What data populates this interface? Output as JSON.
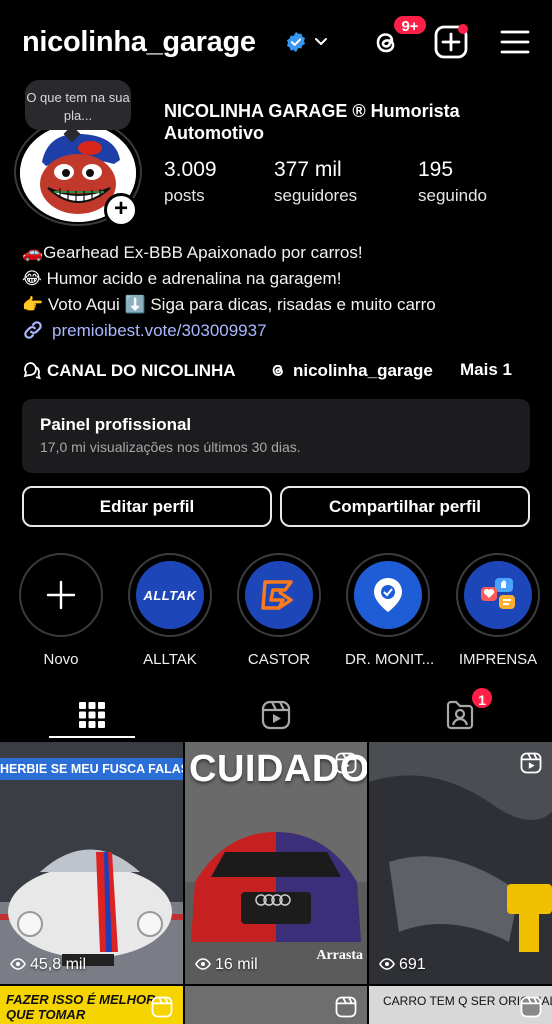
{
  "header": {
    "username": "nicolinha_garage",
    "notification_count": "9+",
    "icons": [
      "verified-badge-icon",
      "chevron-down-icon",
      "threads-icon",
      "add-post-icon",
      "hamburger-menu-icon"
    ]
  },
  "profile": {
    "note_bubble": "O que tem na sua pla...",
    "full_name": "NICOLINHA GARAGE ®  Humorista Automotivo",
    "stats": [
      {
        "value": "3.009",
        "label": "posts"
      },
      {
        "value": "377 mil",
        "label": "seguidores"
      },
      {
        "value": "195",
        "label": "seguindo"
      }
    ],
    "bio": [
      "🚗Gearhead Ex-BBB Apaixonado por carros!",
      "😂 Humor acido e adrenalina na garagem!",
      "👉 Voto Aqui ⬇️ Siga para dicas, risadas e muito carro"
    ],
    "link": "premioibest.vote/303009937",
    "chips": {
      "channel": "CANAL DO NICOLINHA",
      "threads": "nicolinha_garage",
      "more": "Mais 1"
    }
  },
  "pro_panel": {
    "title": "Painel profissional",
    "subtitle": "17,0 mi visualizações nos últimos 30 dias."
  },
  "buttons": {
    "edit": "Editar perfil",
    "share": "Compartilhar perfil"
  },
  "highlights": [
    {
      "label": "Novo"
    },
    {
      "label": "ALLTAK",
      "logo_text": "ALLTAK"
    },
    {
      "label": "CASTOR"
    },
    {
      "label": "DR. MONIT..."
    },
    {
      "label": "IMPRENSA"
    }
  ],
  "tabs": {
    "tagged_badge": "1"
  },
  "posts": [
    {
      "caption": "HERBIE SE MEU FUSCA FALASSE",
      "views": "45,8 mil"
    },
    {
      "caption": "CUIDADO",
      "corner_text": "Arrasta",
      "views": "16 mil"
    },
    {
      "caption": "",
      "views": "691"
    },
    {
      "caption": "FAZER ISSO É MELHOR QUE TOMAR CALMANTE"
    },
    {
      "caption": ""
    },
    {
      "caption": "CARRO TEM Q SER ORIGINAL"
    }
  ],
  "colors": {
    "background": "#000000",
    "accent_red": "#ff1f47",
    "verified_blue": "#3897f0",
    "link": "#aab8ff"
  }
}
